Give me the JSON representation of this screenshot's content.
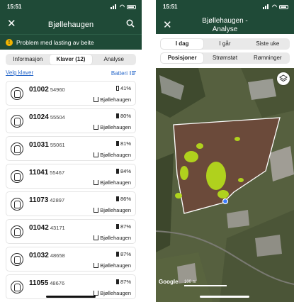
{
  "left": {
    "status_time": "15:51",
    "title": "Bjøllehaugen",
    "warning": "Problem med lasting av beite",
    "tabs": [
      {
        "label": "Informasjon"
      },
      {
        "label": "Klaver (12)"
      },
      {
        "label": "Analyse"
      }
    ],
    "select_label": "Velg klaver",
    "sort_label": "Batteri",
    "items": [
      {
        "id": "01002",
        "code": "54960",
        "battery": "41%",
        "location": "Bjøllehaugen"
      },
      {
        "id": "01024",
        "code": "55504",
        "battery": "80%",
        "location": "Bjøllehaugen"
      },
      {
        "id": "01031",
        "code": "55061",
        "battery": "81%",
        "location": "Bjøllehaugen"
      },
      {
        "id": "11041",
        "code": "55467",
        "battery": "84%",
        "location": "Bjøllehaugen"
      },
      {
        "id": "11073",
        "code": "42897",
        "battery": "86%",
        "location": "Bjøllehaugen"
      },
      {
        "id": "01042",
        "code": "43171",
        "battery": "87%",
        "location": "Bjøllehaugen"
      },
      {
        "id": "01032",
        "code": "48658",
        "battery": "87%",
        "location": "Bjøllehaugen"
      },
      {
        "id": "11055",
        "code": "48676",
        "battery": "87%",
        "location": "Bjøllehaugen"
      }
    ]
  },
  "right": {
    "status_time": "15:51",
    "title_line1": "Bjøllehaugen -",
    "title_line2": "Analyse",
    "period_tabs": [
      {
        "label": "I dag"
      },
      {
        "label": "I går"
      },
      {
        "label": "Siste uke"
      }
    ],
    "view_tabs": [
      {
        "label": "Posisjoner"
      },
      {
        "label": "Strømstøt"
      },
      {
        "label": "Rømninger"
      }
    ],
    "map_attribution": "Google",
    "map_scale": "100 m"
  },
  "colors": {
    "header": "#1f4a37",
    "link": "#2767c9",
    "warning": "#f4b400",
    "heat": "#b8e01a",
    "position_dot": "#3b7cff"
  }
}
